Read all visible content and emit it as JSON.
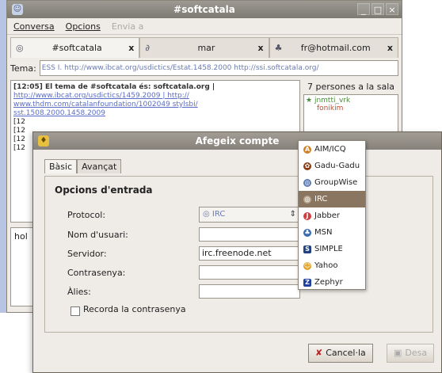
{
  "chat_window": {
    "title": "#softcatala",
    "menus": [
      "Conversa",
      "Opcions",
      "Envia a"
    ],
    "tabs": [
      {
        "label": "#softcatala",
        "close": "x"
      },
      {
        "label": "mar",
        "close": "x"
      },
      {
        "label": "fr@hotmail.com",
        "close": "x"
      }
    ],
    "topic_label": "Tema:",
    "topic_value": "ESS I. http://www.ibcat.org/usdictics/Estat.1458.2000 http://ssi.softcatala.org/",
    "log_lines": [
      "[12:05] El tema de #softcatala és: softcatala.org |",
      "http://www.ibcat.org/usdictics/1459.2009 | http://",
      "www.thdm.com/catalanfoundation/1002049 stylsbi/",
      "sst.1508.2000.1458.2009",
      "[12",
      "[12",
      "[12",
      "[12"
    ],
    "roster_count": "7 persones a la sala",
    "roster_users": [
      "jnmtti_vrk",
      "fonikim"
    ],
    "input_text": "hol"
  },
  "dialog": {
    "title": "Afegeix compte",
    "tabs": [
      "Bàsic",
      "Avançat"
    ],
    "section_title": "Opcions d'entrada",
    "fields": {
      "protocol_label": "Protocol:",
      "protocol_value": "IRC",
      "username_label": "Nom d'usuari:",
      "username_value": "",
      "server_label": "Servidor:",
      "server_value": "irc.freenode.net",
      "password_label": "Contrasenya:",
      "password_value": "",
      "alias_label": "Àlies:",
      "alias_value": ""
    },
    "remember_label": "Recorda la contrasenya",
    "cancel_label": "Cancel·la",
    "save_label": "Desa"
  },
  "protocol_menu": {
    "items": [
      {
        "label": "AIM/ICQ",
        "icon": "aim-icon",
        "color": "#d08020"
      },
      {
        "label": "Gadu-Gadu",
        "icon": "gadu-gadu-icon",
        "color": "#8a3a10"
      },
      {
        "label": "GroupWise",
        "icon": "groupwise-icon",
        "color": "#5a7ab0"
      },
      {
        "label": "IRC",
        "icon": "irc-icon",
        "color": "#8a7560"
      },
      {
        "label": "Jabber",
        "icon": "jabber-icon",
        "color": "#d04040"
      },
      {
        "label": "MSN",
        "icon": "msn-icon",
        "color": "#3a6ab0"
      },
      {
        "label": "SIMPLE",
        "icon": "simple-icon",
        "color": "#204080"
      },
      {
        "label": "Yahoo",
        "icon": "yahoo-icon",
        "color": "#e0a020"
      },
      {
        "label": "Zephyr",
        "icon": "zephyr-icon",
        "color": "#2040a0"
      }
    ],
    "selected": "IRC"
  }
}
